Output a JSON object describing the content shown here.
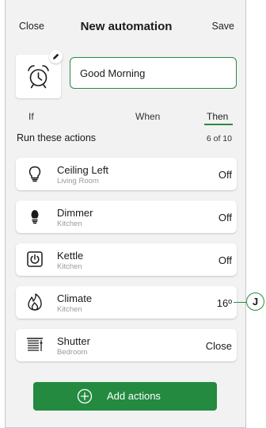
{
  "header": {
    "close_label": "Close",
    "title": "New automation",
    "save_label": "Save"
  },
  "automation": {
    "name": "Good Morning",
    "icon": "alarm-clock-icon"
  },
  "tabs": [
    {
      "label": "If",
      "active": false
    },
    {
      "label": "When",
      "active": false
    },
    {
      "label": "Then",
      "active": true
    }
  ],
  "actions_section": {
    "title": "Run these actions",
    "count": "6 of 10"
  },
  "actions": [
    {
      "name": "Ceiling Left",
      "room": "Living Room",
      "state": "Off",
      "icon": "bulb-icon"
    },
    {
      "name": "Dimmer",
      "room": "Kitchen",
      "state": "Off",
      "icon": "dimmer-bulb-icon"
    },
    {
      "name": "Kettle",
      "room": "Kitchen",
      "state": "Off",
      "icon": "power-icon"
    },
    {
      "name": "Climate",
      "room": "Kitchen",
      "state": "16º",
      "icon": "flame-icon"
    },
    {
      "name": "Shutter",
      "room": "Bedroom",
      "state": "Close",
      "icon": "shutter-icon"
    }
  ],
  "callout_letter": "J",
  "add_button": {
    "label": "Add actions",
    "icon": "plus-circle-icon"
  },
  "colors": {
    "accent": "#2a8a44",
    "button": "#238a3f"
  }
}
